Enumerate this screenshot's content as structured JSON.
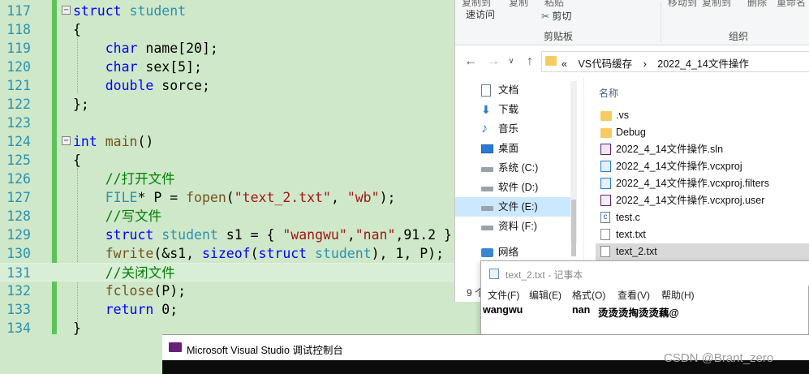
{
  "editor": {
    "lines": [
      {
        "num": "117",
        "fold": "−",
        "tokens": [
          [
            "kw",
            "struct"
          ],
          [
            "ty",
            " student"
          ]
        ]
      },
      {
        "num": "118",
        "tokens": [
          [
            "",
            "{"
          ]
        ]
      },
      {
        "num": "119",
        "tokens": [
          [
            "",
            "    "
          ],
          [
            "kw",
            "char"
          ],
          [
            "",
            " name[20];"
          ]
        ]
      },
      {
        "num": "120",
        "tokens": [
          [
            "",
            "    "
          ],
          [
            "kw",
            "char"
          ],
          [
            "",
            " sex[5];"
          ]
        ]
      },
      {
        "num": "121",
        "tokens": [
          [
            "",
            "    "
          ],
          [
            "kw",
            "double"
          ],
          [
            "",
            " sorce;"
          ]
        ]
      },
      {
        "num": "122",
        "tokens": [
          [
            "",
            "};"
          ]
        ]
      },
      {
        "num": "123",
        "tokens": []
      },
      {
        "num": "124",
        "fold": "−",
        "tokens": [
          [
            "kw",
            "int"
          ],
          [
            "",
            " "
          ],
          [
            "fn",
            "main"
          ],
          [
            "",
            "()"
          ]
        ]
      },
      {
        "num": "125",
        "tokens": [
          [
            "",
            "{"
          ]
        ]
      },
      {
        "num": "126",
        "tokens": [
          [
            "",
            "    "
          ],
          [
            "cm",
            "//打开文件"
          ]
        ]
      },
      {
        "num": "127",
        "tokens": [
          [
            "",
            "    "
          ],
          [
            "ty",
            "FILE"
          ],
          [
            "",
            "* P = "
          ],
          [
            "fn",
            "fopen"
          ],
          [
            "",
            "("
          ],
          [
            "str",
            "\"text_2.txt\""
          ],
          [
            "",
            ", "
          ],
          [
            "str",
            "\"wb\""
          ],
          [
            "",
            ");"
          ]
        ]
      },
      {
        "num": "128",
        "tokens": [
          [
            "",
            "    "
          ],
          [
            "cm",
            "//写文件"
          ]
        ]
      },
      {
        "num": "129",
        "tokens": [
          [
            "",
            "    "
          ],
          [
            "kw",
            "struct"
          ],
          [
            "ty",
            " student"
          ],
          [
            "",
            " s1 = { "
          ],
          [
            "str",
            "\"wangwu\""
          ],
          [
            "",
            ","
          ],
          [
            "str",
            "\"nan\""
          ],
          [
            "",
            ",91.2 };"
          ]
        ]
      },
      {
        "num": "130",
        "tokens": [
          [
            "",
            "    "
          ],
          [
            "fn",
            "fwrite"
          ],
          [
            "",
            "(&s1, "
          ],
          [
            "kw",
            "sizeof"
          ],
          [
            "",
            "("
          ],
          [
            "kw",
            "struct"
          ],
          [
            "ty",
            " student"
          ],
          [
            "",
            "), 1, P);"
          ]
        ]
      },
      {
        "num": "131",
        "current": true,
        "tokens": [
          [
            "",
            "    "
          ],
          [
            "cm",
            "//关闭文件"
          ]
        ]
      },
      {
        "num": "132",
        "tokens": [
          [
            "",
            "    "
          ],
          [
            "fn",
            "fclose"
          ],
          [
            "",
            "(P);"
          ]
        ]
      },
      {
        "num": "133",
        "tokens": [
          [
            "",
            "    "
          ],
          [
            "kw",
            "return"
          ],
          [
            "",
            " 0;"
          ]
        ]
      },
      {
        "num": "134",
        "tokens": [
          [
            "",
            "}"
          ]
        ]
      }
    ]
  },
  "explorer": {
    "ribbon": {
      "top_left_1": "复制到",
      "top_left_2": "复制",
      "quick_access": "速访问",
      "paste_label": "粘贴",
      "cut_label": "剪切",
      "clipboard_group": "剪贴板",
      "move_to": "移动到",
      "copy_to": "复制到",
      "delete_label": "删除",
      "rename_label": "重命名",
      "organize_group": "组织"
    },
    "address": {
      "chevrons": "«",
      "crumb1": "VS代码缓存",
      "arrow": "›",
      "crumb2": "2022_4_14文件操作"
    },
    "nav": [
      {
        "label": "文档",
        "icon": "document-icon"
      },
      {
        "label": "下载",
        "icon": "download-icon"
      },
      {
        "label": "音乐",
        "icon": "music-icon"
      },
      {
        "label": "桌面",
        "icon": "desktop-icon"
      },
      {
        "label": "系统 (C:)",
        "icon": "drive-icon"
      },
      {
        "label": "软件 (D:)",
        "icon": "drive-icon"
      },
      {
        "label": "文件 (E:)",
        "icon": "drive-icon",
        "selected": true
      },
      {
        "label": "资料 (F:)",
        "icon": "drive-icon"
      },
      {
        "label": "网络",
        "icon": "network-icon"
      }
    ],
    "status_count": "9 个",
    "column_name": "名称",
    "files": [
      {
        "name": ".vs",
        "icon": "folder-icon"
      },
      {
        "name": "Debug",
        "icon": "folder-icon"
      },
      {
        "name": "2022_4_14文件操作.sln",
        "icon": "solution-icon"
      },
      {
        "name": "2022_4_14文件操作.vcxproj",
        "icon": "vcxproj-icon"
      },
      {
        "name": "2022_4_14文件操作.vcxproj.filters",
        "icon": "vcxproj-icon"
      },
      {
        "name": "2022_4_14文件操作.vcxproj.user",
        "icon": "vcxproj-user-icon"
      },
      {
        "name": "test.c",
        "icon": "c-file-icon"
      },
      {
        "name": "text.txt",
        "icon": "text-file-icon"
      },
      {
        "name": "text_2.txt",
        "icon": "text-file-icon",
        "selected": true
      }
    ]
  },
  "notepad": {
    "title": "text_2.txt - 记事本",
    "menu": [
      "文件(F)",
      "编辑(E)",
      "格式(O)",
      "查看(V)",
      "帮助(H)"
    ],
    "content": {
      "name": "wangwu",
      "sex": "nan",
      "garbage": "烫烫烫掏烫烫藕@"
    }
  },
  "console": {
    "title": "Microsoft Visual Studio 调试控制台"
  },
  "watermark": "CSDN @Brant_zero",
  "colors": {
    "editor_bg": "#cfe8c9",
    "keyword": "#0000ff",
    "type": "#2b91af",
    "string": "#a31515",
    "comment": "#008000",
    "selection": "#cce8ff"
  }
}
